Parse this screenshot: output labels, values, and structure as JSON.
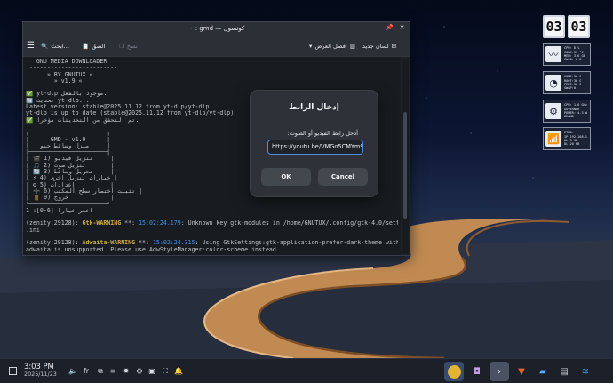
{
  "window": {
    "title": "~ : gmd — كونسول",
    "toolbar": {
      "new_tab": "لسان جديد",
      "split_view": "افصل العرض",
      "copy": "نسخ",
      "paste": "الصق",
      "search": "ابحث..."
    }
  },
  "terminal": {
    "lines": [
      "   GNU MEDIA DOWNLOADER",
      " -------------------------",
      "      » BY GNUTUX «",
      "        » v1.9 «",
      "",
      "✅ yt-dlp موجود بالفعل.",
      "🔄 تحديث yt-dlp...",
      "Latest version: stable@2025.11.12 from yt-dlp/yt-dlp",
      "yt-dlp is up to date (stable@2025.11.12 from yt-dlp/yt-dlp)",
      "✅ تم التحقق من التحديثات مؤخراً.",
      "",
      "┌──────────────────────┐",
      "│      GMD - v1.9      │",
      "│   منزل وسائط جنو     │",
      "├──────────────────────┤",
      "│ 🎬 1) تنزيل فيديو     │",
      "│ 🎵 2) تنزيل صوت       │",
      "│ 🔄 3) تحويل وسائط     │",
      "│ ⚡ 4) خيارات تنزيل أخرى │",
      "│ ⚙ 5) إعدادات          │",
      "│ ➕ 6) تثبيت اختصار سطح المكتب │",
      "│ 🚪 0) خروج            │",
      "└──────────────────────┘",
      "1 :[0-6] اختر خياراً",
      "",
      "(zenity:29128): Gtk-WARNING **: 15:02:24.179: Unknown key gtk-modules in /home/GNUTUX/.config/gtk-4.0/settings",
      ".ini",
      "",
      "(zenity:29128): Adwaita-WARNING **: 15:02:24.315: Using GtkSettings:gtk-application-prefer-dark-theme with lib",
      "adwaita is unsupported. Please use AdwStyleManager:color-scheme instead.",
      ""
    ]
  },
  "dialog": {
    "title": "إدخال الرابط",
    "label": "أدخل رابط الفيديو أو الصوت:",
    "input_value": "https://youtu.be/VMGo5CMYm9U",
    "ok": "OK",
    "cancel": "Cancel"
  },
  "widgets": {
    "clock_hours": "03",
    "clock_minutes": "03",
    "mon1": "CPU: 8 %\nCORE:37 °C\nMEM: 3.6 GB\nSWAP: 0 B",
    "mon2": "HOME:36 G\nROOT:36 G\nFREE:36 G\nSWAP:0",
    "mon3": "CPU: 1.6 GHz\nGOVERNOR\nPOWER: 4.3 W\nBRAND",
    "mon4": "ETH0:\nIP:192.168.1.3\nUL:3 KB\nDL:20 KB"
  },
  "taskbar": {
    "time": "3:03 PM",
    "date": "2025/11/23",
    "keyboard_layout": "fr"
  },
  "colors": {
    "accent": "#4d8fe6",
    "warning": "#e8c14a",
    "timestamp": "#4da3ff"
  }
}
